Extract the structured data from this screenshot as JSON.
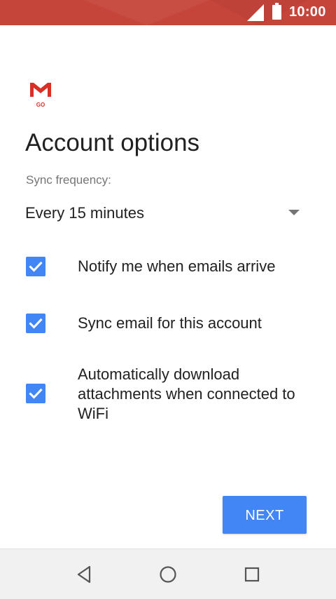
{
  "status_bar": {
    "time": "10:00",
    "signal_icon": "cellular-signal-icon",
    "battery_icon": "battery-full-icon",
    "background_color": "#c6453a"
  },
  "app": {
    "logo_icon": "gmail-go-logo",
    "logo_text": "GO"
  },
  "page": {
    "title": "Account options"
  },
  "sync": {
    "label": "Sync frequency:",
    "value": "Every 15 minutes"
  },
  "options": [
    {
      "label": "Notify me when emails arrive",
      "checked": true
    },
    {
      "label": "Sync email for this account",
      "checked": true
    },
    {
      "label": "Automatically download attachments when connected to WiFi",
      "checked": true
    }
  ],
  "actions": {
    "next_label": "NEXT",
    "accent_color": "#4285f4"
  },
  "nav_bar": {
    "back_icon": "back-triangle-icon",
    "home_icon": "home-circle-icon",
    "recents_icon": "recents-square-icon"
  }
}
